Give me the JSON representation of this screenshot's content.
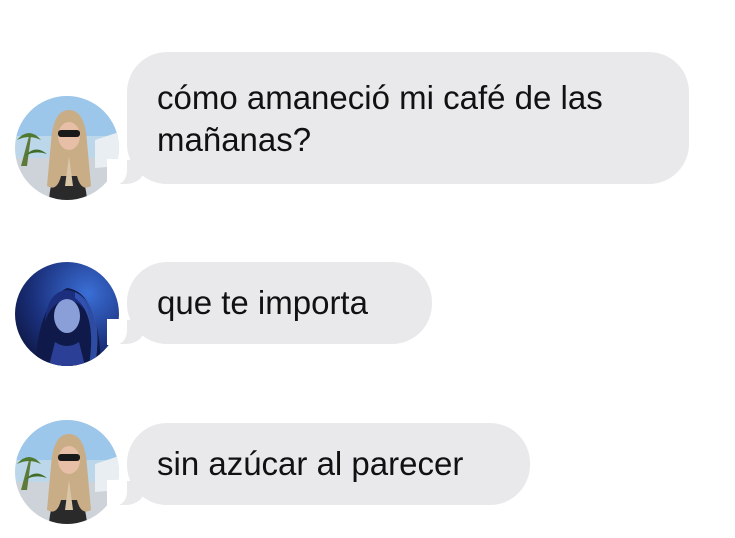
{
  "messages": [
    {
      "sender": "A",
      "avatar_icon": "avatar-blonde-woman-beach",
      "text": "cómo amaneció mi café de las\nmañanas?"
    },
    {
      "sender": "B",
      "avatar_icon": "avatar-woman-blue-light",
      "text": "que te importa"
    },
    {
      "sender": "A",
      "avatar_icon": "avatar-blonde-woman-beach",
      "text": "sin azúcar al parecer"
    }
  ],
  "colors": {
    "bubble_background": "#e9e9eb",
    "text": "#111111",
    "page_background": "#ffffff"
  }
}
